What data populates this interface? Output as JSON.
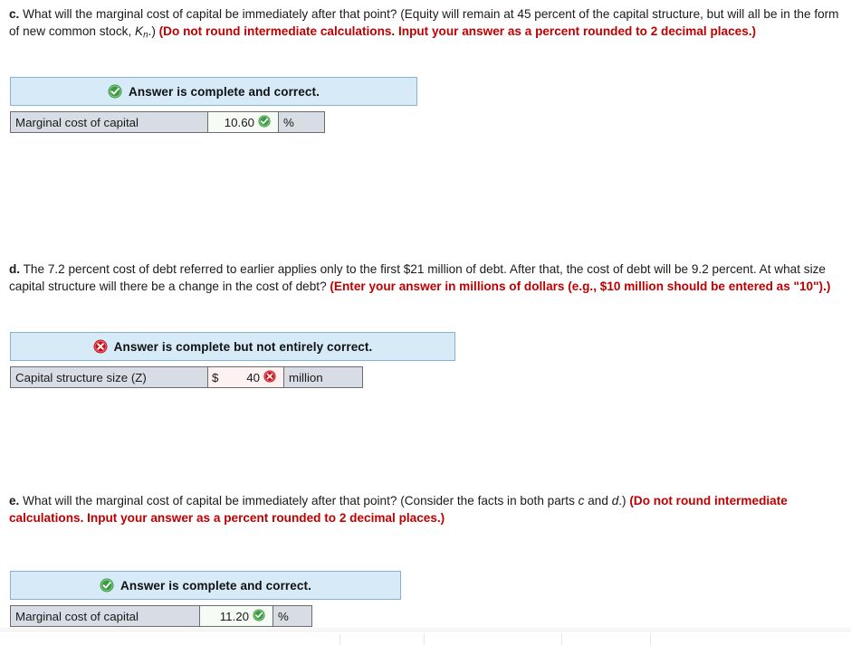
{
  "document": {
    "type": "homework-answer-review"
  },
  "colors": {
    "red_emphasis": "#c00000",
    "banner_background": "#d6eaf8",
    "banner_border": "#86b2d6",
    "correct_green": "#3a9b41",
    "incorrect_red": "#c9121d",
    "label_cell_background": "#d8dce4",
    "correct_cell_background": "#f6fbf5",
    "incorrect_cell_background": "#fdf1f1"
  },
  "parts": [
    {
      "id": "part-c",
      "letter": "c.",
      "question_plain": "What will the marginal cost of capital be immediately after that point? (Equity will remain at 45 percent of the capital structure, but will all be in the form of new common stock, Kn.)",
      "question_segments": [
        {
          "type": "text",
          "value": "What will the marginal cost of capital be immediately after that point? (Equity will remain at 45 percent of the capital structure, but will all be in the form of new common stock, "
        },
        {
          "type": "symbol_italic",
          "value": "K"
        },
        {
          "type": "symbol_subscript",
          "value": "n"
        },
        {
          "type": "text",
          "value": ".) "
        },
        {
          "type": "red_bold",
          "value": "(Do not round intermediate calculations. Input your answer as a percent rounded to 2 decimal places.)"
        }
      ],
      "status": {
        "icon": "check-circle-icon",
        "text": "Answer is complete and correct.",
        "state": "correct"
      },
      "answer": {
        "label": "Marginal cost of capital",
        "currency_prefix": "",
        "value": "10.60",
        "unit": "%",
        "state": "correct",
        "marker_icon": "check-circle-icon"
      }
    },
    {
      "id": "part-d",
      "letter": "d.",
      "question_plain": "The 7.2 percent cost of debt referred to earlier applies only to the first $21 million of debt. After that, the cost of debt will be 9.2 percent. At what size capital structure will there be a change in the cost of debt?",
      "question_segments": [
        {
          "type": "text",
          "value": "The 7.2 percent cost of debt referred to earlier applies only to the first $21 million of debt. After that, the cost of debt will be 9.2 percent. At what size capital structure will there be a change in the cost of debt? "
        },
        {
          "type": "red_bold",
          "value": "(Enter your answer in millions of dollars (e.g., $10 million should be entered as \"10\").)"
        }
      ],
      "status": {
        "icon": "x-circle-icon",
        "text": "Answer is complete but not entirely correct.",
        "state": "incorrect"
      },
      "answer": {
        "label": "Capital structure size (Z)",
        "currency_prefix": "$",
        "value": "40",
        "unit": "million",
        "state": "incorrect",
        "marker_icon": "x-circle-icon"
      }
    },
    {
      "id": "part-e",
      "letter": "e.",
      "question_plain": "What will the marginal cost of capital be immediately after that point? (Consider the facts in both parts c and d.)",
      "question_segments": [
        {
          "type": "text",
          "value": "What will the marginal cost of capital be immediately after that point? (Consider the facts in both parts "
        },
        {
          "type": "italic",
          "value": "c"
        },
        {
          "type": "text",
          "value": " and "
        },
        {
          "type": "italic",
          "value": "d"
        },
        {
          "type": "text",
          "value": ".) "
        },
        {
          "type": "red_bold",
          "value": "(Do not round intermediate calculations. Input your answer as a percent rounded to 2 decimal places.)"
        }
      ],
      "status": {
        "icon": "check-circle-icon",
        "text": "Answer is complete and correct.",
        "state": "correct"
      },
      "answer": {
        "label": "Marginal cost of capital",
        "currency_prefix": "",
        "value": "11.20",
        "unit": "%",
        "state": "correct",
        "marker_icon": "check-circle-icon"
      }
    }
  ]
}
